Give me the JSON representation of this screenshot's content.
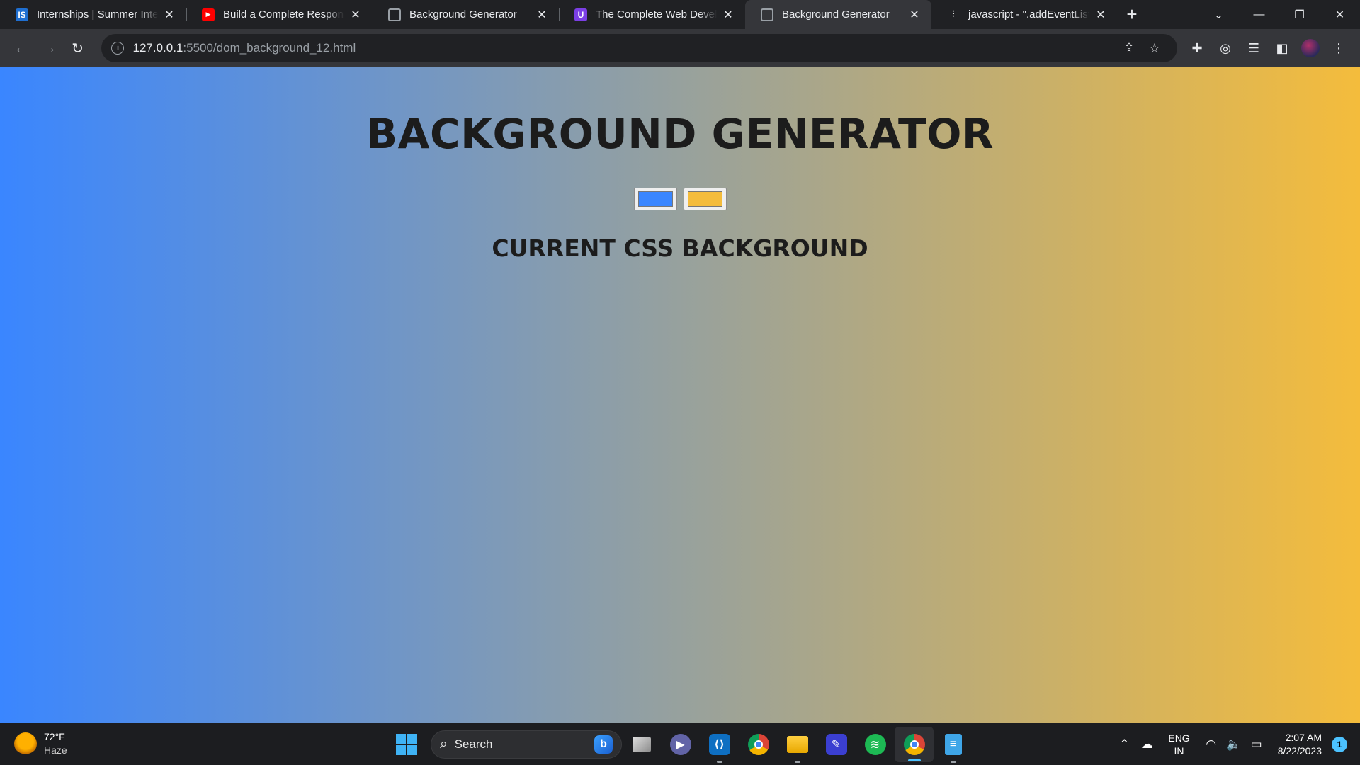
{
  "browser": {
    "tabs": [
      {
        "title": "Internships | Summer Internships",
        "favicon": "IS",
        "favicon_kind": "internshala-icon",
        "active": false
      },
      {
        "title": "Build a Complete Responsive Website",
        "favicon": "▶",
        "favicon_kind": "youtube-icon",
        "active": false
      },
      {
        "title": "Background Generator",
        "favicon": "",
        "favicon_kind": "globe-icon",
        "active": false
      },
      {
        "title": "The Complete Web Developer",
        "favicon": "U",
        "favicon_kind": "udemy-icon",
        "active": false
      },
      {
        "title": "Background Generator",
        "favicon": "",
        "favicon_kind": "globe-icon",
        "active": true
      },
      {
        "title": "javascript - \".addEventListener",
        "favicon": "⫶",
        "favicon_kind": "stackoverflow-icon",
        "active": false
      }
    ],
    "new_tab_symbol": "+",
    "address": {
      "host": "127.0.0.1",
      "rest": ":5500/dom_background_12.html"
    }
  },
  "page": {
    "title": "BACKGROUND GENERATOR",
    "color1": "#3a86ff",
    "color2": "#f4bc3c",
    "css_heading": "CURRENT CSS BACKGROUND"
  },
  "taskbar": {
    "weather": {
      "temp": "72°F",
      "condition": "Haze"
    },
    "search_placeholder": "Search",
    "apps": [
      "task-view",
      "teams-chat",
      "vscode",
      "chrome",
      "file-explorer",
      "edit-app",
      "spotify",
      "chrome-profile",
      "notepad"
    ],
    "language": {
      "line1": "ENG",
      "line2": "IN"
    },
    "time": "2:07 AM",
    "date": "8/22/2023",
    "notifications": "1"
  }
}
